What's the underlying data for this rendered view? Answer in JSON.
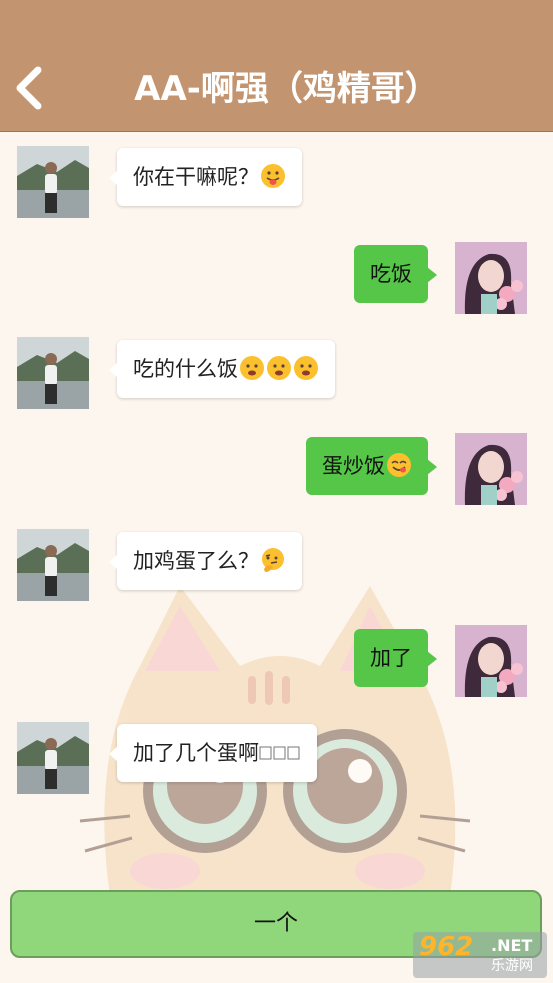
{
  "header": {
    "title": "AA-啊强（鸡精哥）",
    "back_icon": "chevron-left-icon",
    "bg_color": "#c2946f"
  },
  "messages": [
    {
      "side": "left",
      "text": "你在干嘛呢？",
      "emoji": "tongue-out-emoji"
    },
    {
      "side": "right",
      "text": "吃饭",
      "emoji": ""
    },
    {
      "side": "left",
      "text": "吃的什么饭",
      "emoji": "drooling-emoji x3"
    },
    {
      "side": "right",
      "text": "蛋炒饭",
      "emoji": "yum-emoji"
    },
    {
      "side": "left",
      "text": "加鸡蛋了么？",
      "emoji": "thinking-emoji"
    },
    {
      "side": "right",
      "text": "加了",
      "emoji": ""
    },
    {
      "side": "left",
      "text": "加了几个蛋啊",
      "emoji": "missing-glyph-boxes"
    }
  ],
  "bottom_button": {
    "label": "一个"
  },
  "watermark": {
    "number": "962",
    "suffix": ".NET",
    "cn": "乐游网"
  },
  "colors": {
    "right_bubble": "#56c648",
    "left_bubble": "#ffffff",
    "button": "#8fd77a",
    "background": "#fdf6ee"
  }
}
